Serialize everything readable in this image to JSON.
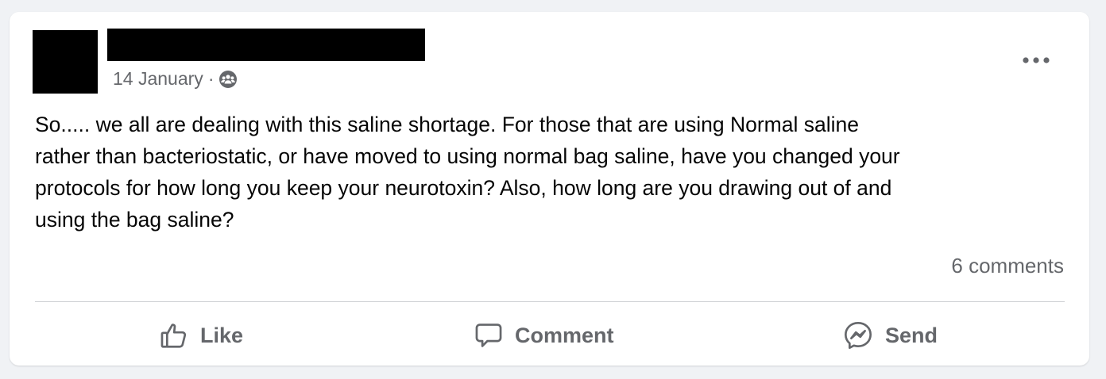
{
  "post": {
    "date": "14 January",
    "separator": "·",
    "audience_icon": "group-audience-icon",
    "more_icon": "more-options-icon",
    "text": "So.....  we all are dealing with this saline shortage.  For those that are using Normal saline\nrather than bacteriostatic, or have moved to using normal bag saline, have you changed your\nprotocols for how long you keep your neurotoxin? Also, how long are you drawing out of and\nusing the bag saline?",
    "comments_label": "6 comments"
  },
  "actions": {
    "like_label": "Like",
    "comment_label": "Comment",
    "send_label": "Send"
  },
  "colors": {
    "background": "#f0f2f5",
    "card": "#ffffff",
    "text_primary": "#050505",
    "text_secondary": "#65676b",
    "divider": "#ced0d4",
    "redaction": "#000000"
  }
}
